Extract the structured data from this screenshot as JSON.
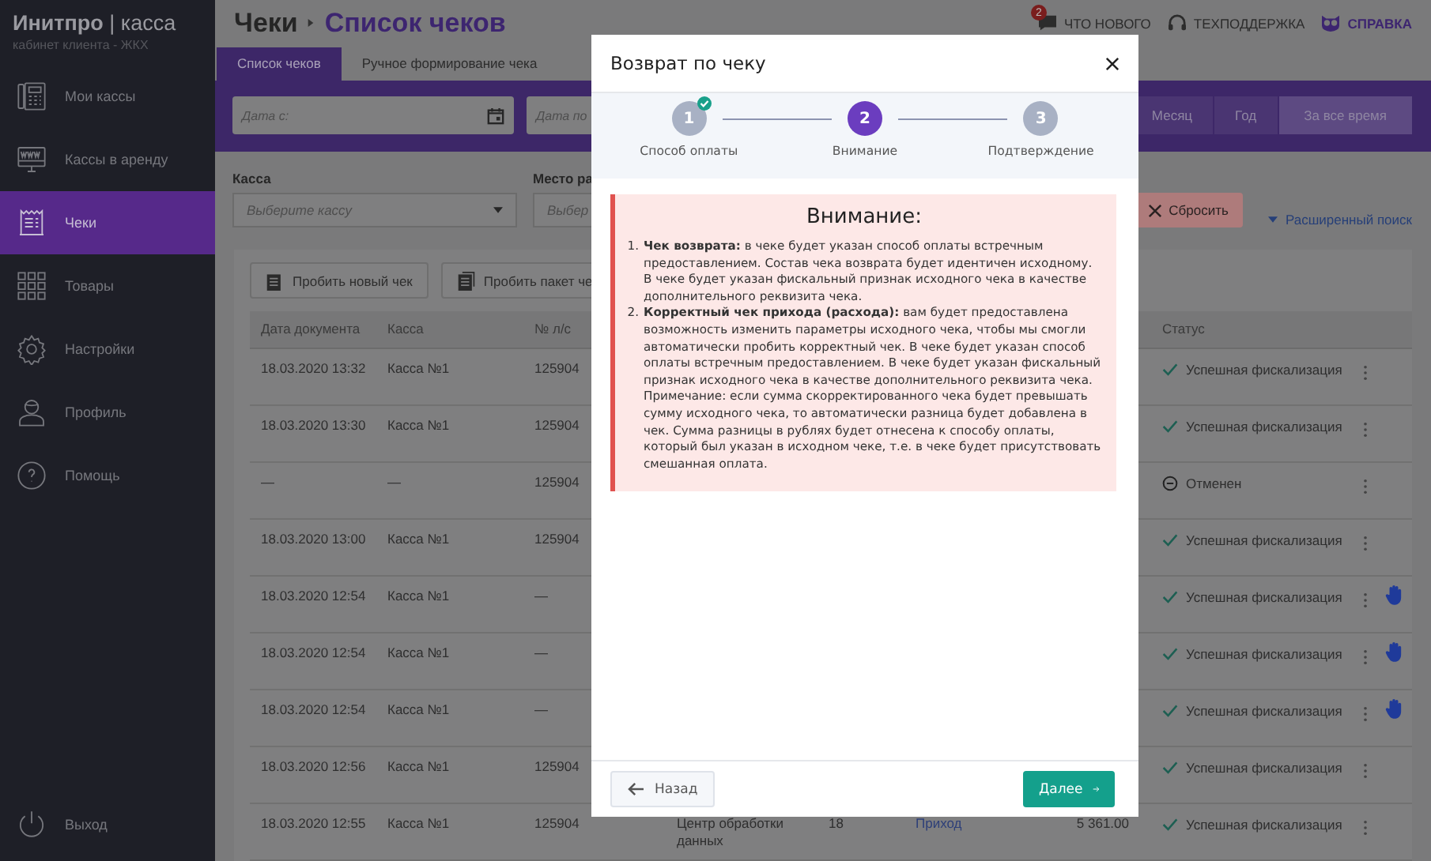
{
  "sidebar": {
    "brand": "**Инитпро** | касса",
    "subtitle": "кабинет клиента - ЖКХ",
    "items": [
      {
        "label": "Мои кассы",
        "selected": false
      },
      {
        "label": "Кассы в аренду",
        "selected": false
      },
      {
        "label": "Чеки",
        "selected": true
      },
      {
        "label": "Товары",
        "selected": false
      },
      {
        "label": "Настройки",
        "selected": false
      },
      {
        "label": "Профиль",
        "selected": false
      },
      {
        "label": "Помощь",
        "selected": false
      }
    ],
    "logout": "Выход"
  },
  "header": {
    "section": "Чеки",
    "page": "Список чеков",
    "links": [
      {
        "label": "ЧТО НОВОГО",
        "badge": "2",
        "highlighted": false
      },
      {
        "label": "ТЕХПОДДЕРЖКА",
        "highlighted": false
      },
      {
        "label": "СПРАВКА",
        "highlighted": true
      }
    ]
  },
  "tabs": [
    {
      "label": "Список чеков",
      "selected": true
    },
    {
      "label": "Ручное формирование чека",
      "selected": false
    }
  ],
  "date_filters": [
    {
      "placeholder": "Дата с:"
    },
    {
      "placeholder": "Дата по"
    }
  ],
  "periods": [
    {
      "label": "Месяц",
      "selected": false
    },
    {
      "label": "Год",
      "selected": false
    },
    {
      "label": "За все время",
      "selected": true
    }
  ],
  "filters": [
    {
      "label": "Касса",
      "placeholder": "Выберите кассу"
    },
    {
      "label": "Место ра",
      "placeholder": "Выбер"
    }
  ],
  "reset_button": "Сбросить",
  "advanced_search": "Расширенный поиск",
  "actions": [
    "Пробить новый чек",
    "Пробить пакет че"
  ],
  "table": {
    "columns": {
      "date": "Дата документа",
      "kassa": "Касса",
      "account": "№ л/с",
      "status": "Статус"
    },
    "rows": [
      {
        "date": "18.03.2020 13:32",
        "kassa": "Касса №1",
        "account": "125904",
        "status": {
          "kind": "success",
          "text": "Успешная фискализация"
        },
        "manual": false
      },
      {
        "date": "18.03.2020 13:30",
        "kassa": "Касса №1",
        "account": "125904",
        "status": {
          "kind": "success",
          "text": "Успешная фискализация"
        },
        "manual": false
      },
      {
        "date": "—",
        "kassa": "—",
        "account": "125904",
        "status": {
          "kind": "cancelled",
          "text": "Отменен"
        },
        "manual": false
      },
      {
        "date": "18.03.2020 13:00",
        "kassa": "Касса №1",
        "account": "125904",
        "status": {
          "kind": "success",
          "text": "Успешная фискализация"
        },
        "manual": false
      },
      {
        "date": "18.03.2020 12:54",
        "kassa": "Касса №1",
        "account": "—",
        "status": {
          "kind": "success",
          "text": "Успешная фискализация"
        },
        "manual": true
      },
      {
        "date": "18.03.2020 12:54",
        "kassa": "Касса №1",
        "account": "—",
        "status": {
          "kind": "success",
          "text": "Успешная фискализация"
        },
        "manual": true
      },
      {
        "date": "18.03.2020 12:54",
        "kassa": "Касса №1",
        "account": "—",
        "status": {
          "kind": "success",
          "text": "Успешная фискализация"
        },
        "manual": true
      },
      {
        "date": "18.03.2020 12:56",
        "kassa": "Касса №1",
        "account": "125904",
        "status": {
          "kind": "success",
          "text": "Успешная фискализация"
        },
        "manual": false
      },
      {
        "date": "18.03.2020 12:55",
        "kassa": "Касса №1",
        "account": "125904",
        "column_4": "Центр обработки данных",
        "column_5": "18",
        "column_6": "Приход",
        "column_7": "5 361.00",
        "status": {
          "kind": "success",
          "text": "Успешная фискализация"
        },
        "manual": false
      }
    ]
  },
  "modal": {
    "title": "Возврат по чеку",
    "steps": [
      {
        "number": "1",
        "label": "Способ оплаты",
        "completed": true,
        "selected": false
      },
      {
        "number": "2",
        "label": "Внимание",
        "completed": false,
        "selected": true
      },
      {
        "number": "3",
        "label": "Подтверждение",
        "completed": false,
        "selected": false
      }
    ],
    "notice": {
      "title": "Внимание:",
      "items": [
        {
          "number": "1.",
          "text": "**Чек возврата:** в чеке будет указан способ оплаты встречным предоставлением. Состав чека возврата будет идентичен исходному. В чеке будет указан фискальный признак исходного чека в качестве дополнительного реквизита чека."
        },
        {
          "number": "2.",
          "text": "**Корректный чек прихода (расхода):** вам будет предоставлена возможность изменить параметры исходного чека, чтобы мы смогли автоматически пробить корректный чек. В чеке будет указан способ оплаты встречным предоставлением. В чеке будет указан фискальный признак исходного чека в качестве дополнительного реквизита чека. Примечание: если сумма скорректированного чека будет превышать сумму исходного чека, то автоматически разница будет добавлена в чек. Сумма разницы в рублях будет отнесена к способу оплаты, который был указан в исходном чеке, т.е. в чеке будет присутствовать смешанная оплата."
        }
      ]
    },
    "back": "Назад",
    "next": "Далее"
  }
}
